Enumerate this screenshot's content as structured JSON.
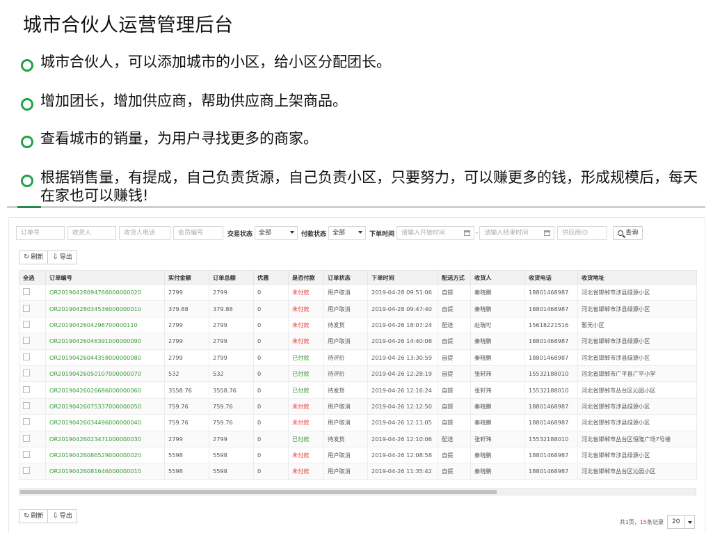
{
  "slide": {
    "title": "城市合伙人运营管理后台",
    "bullets": [
      "城市合伙人，可以添加城市的小区，给小区分配团长。",
      "增加团长，增加供应商，帮助供应商上架商品。",
      "查看城市的销量，为用户寻找更多的商家。",
      "根据销售量，有提成，自己负责货源，自己负责小区，只要努力，可以赚更多的钱，形成规模后，每天在家也可以赚钱!"
    ]
  },
  "filters": {
    "order_no_placeholder": "订单号",
    "receiver_placeholder": "收货人",
    "receiver_phone_placeholder": "收货人电话",
    "member_no_placeholder": "会员编号",
    "trade_status_label": "交易状态",
    "trade_status_value": "全部",
    "pay_status_label": "付款状态",
    "pay_status_value": "全部",
    "order_time_label": "下单时间",
    "start_time_placeholder": "请输入开始时间",
    "end_time_placeholder": "请输入结束时间",
    "supplier_id_placeholder": "供应商ID",
    "search_label": "查询"
  },
  "toolbar": {
    "refresh_label": "刷新",
    "export_label": "导出"
  },
  "table": {
    "headers": [
      "全选",
      "订单编号",
      "实付金额",
      "订单总额",
      "优惠",
      "是否付款",
      "订单状态",
      "下单时间",
      "配送方式",
      "收货人",
      "收货电话",
      "收货地址"
    ],
    "rows": [
      [
        "OR20190428094766000000020",
        "2799",
        "2799",
        "0",
        "未付款",
        "用户取消",
        "2019-04-28 09:51:06",
        "自提",
        "秦晓鹏",
        "18801468987",
        "河北省邯郸市涉县绿源小区"
      ],
      [
        "OR20190428034536000000010",
        "379.88",
        "379.88",
        "0",
        "未付款",
        "用户取消",
        "2019-04-28 09:47:40",
        "自提",
        "秦晓鹏",
        "18801468987",
        "河北省邯郸市涉县绿源小区"
      ],
      [
        "OR2019042604296700000110",
        "2799",
        "2799",
        "0",
        "未付款",
        "待发货",
        "2019-04-26 18:07:24",
        "配送",
        "赵瑞可",
        "15618221516",
        "暂无小区"
      ],
      [
        "OR20190426046391000000090",
        "2799",
        "2799",
        "0",
        "未付款",
        "用户取消",
        "2019-04-26 14:40:08",
        "自提",
        "秦晓鹏",
        "18801468987",
        "河北省邯郸市涉县绿源小区"
      ],
      [
        "OR20190426044358000000080",
        "2799",
        "2799",
        "0",
        "已付款",
        "待评价",
        "2019-04-26 13:30:59",
        "自提",
        "秦晓鹏",
        "18801468987",
        "河北省邯郸市涉县绿源小区"
      ],
      [
        "OR20190426050107000000070",
        "532",
        "532",
        "0",
        "已付款",
        "待评价",
        "2019-04-26 12:28:19",
        "自提",
        "张轩玮",
        "15532188010",
        "河北省邯郸市广平县广平小学"
      ],
      [
        "OR20190426026686000000060",
        "3558.76",
        "3558.76",
        "0",
        "已付款",
        "待发货",
        "2019-04-26 12:16:24",
        "自提",
        "张轩玮",
        "15532188010",
        "河北省邯郸市丛台区沁园小区"
      ],
      [
        "OR20190426075337000000050",
        "759.76",
        "759.76",
        "0",
        "未付款",
        "用户取消",
        "2019-04-26 12:12:50",
        "自提",
        "秦晓鹏",
        "18801468987",
        "河北省邯郸市涉县绿源小区"
      ],
      [
        "OR20190426034496000000040",
        "759.76",
        "759.76",
        "0",
        "未付款",
        "用户取消",
        "2019-04-26 12:11:05",
        "自提",
        "秦晓鹏",
        "18801468987",
        "河北省邯郸市涉县绿源小区"
      ],
      [
        "OR20190426023471000000030",
        "2799",
        "2799",
        "0",
        "已付款",
        "待发货",
        "2019-04-26 12:10:06",
        "配送",
        "张轩玮",
        "15532188010",
        "河北省邯郸市丛台区恒隆广场7号楼"
      ],
      [
        "OR20190426086529000000020",
        "5598",
        "5598",
        "0",
        "未付款",
        "用户取消",
        "2019-04-26 12:08:58",
        "自提",
        "秦晓鹏",
        "18801468987",
        "河北省邯郸市涉县绿源小区"
      ],
      [
        "OR20190426081646000000010",
        "5598",
        "5598",
        "0",
        "未付款",
        "用户取消",
        "2019-04-26 11:35:42",
        "自提",
        "秦晓鹏",
        "18801468987",
        "河北省邯郸市丛台区沁园小区"
      ]
    ]
  },
  "pager": {
    "prefix": "共1页，",
    "count": "15",
    "suffix": "条记录",
    "page_size": "20"
  },
  "colors": {
    "accent_green": "#1fa24a",
    "order_link": "#3a9a3a",
    "unpaid_red": "#e8413a"
  },
  "icons": [
    "refresh-icon",
    "export-icon",
    "calendar-icon",
    "search-icon",
    "chevron-down-icon"
  ]
}
